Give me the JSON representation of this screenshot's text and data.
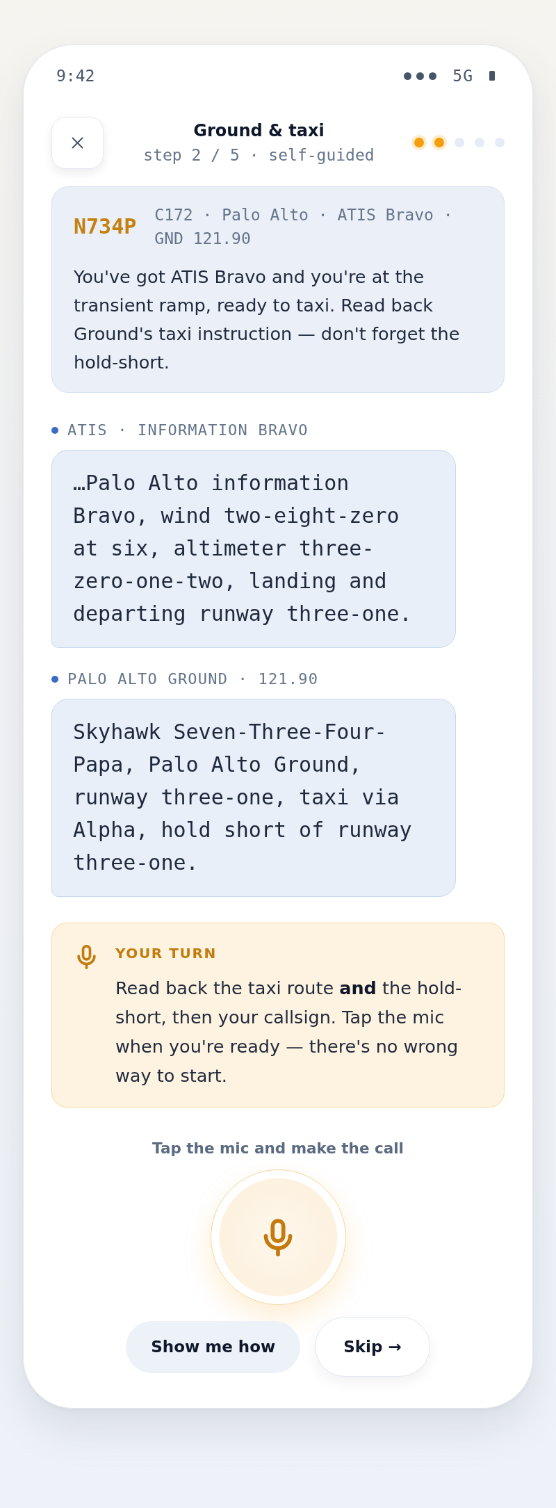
{
  "status_bar": {
    "time": "9:42",
    "network": "5G"
  },
  "header": {
    "title": "Ground & taxi",
    "subtitle": "step 2 / 5 · self-guided",
    "progress": [
      {
        "done": true
      },
      {
        "done": true
      },
      {
        "done": false
      },
      {
        "done": false
      },
      {
        "done": false
      }
    ]
  },
  "briefing": {
    "callsign": "N734P",
    "details": "C172 · Palo Alto · ATIS Bravo · GND 121.90",
    "text": "You've got ATIS Bravo and you're at the transient ramp, ready to taxi. Read back Ground's taxi instruction — don't forget the hold-short."
  },
  "transmissions": [
    {
      "source": "ATIS · INFORMATION BRAVO",
      "text": "…Palo Alto information Bravo, wind two-eight-zero at six, altimeter three-zero-one-two, landing and departing runway three-one."
    },
    {
      "source": "PALO ALTO GROUND · 121.90",
      "text": "Skyhawk Seven-Three-Four-Papa, Palo Alto Ground, runway three-one, taxi via Alpha, hold short of runway three-one."
    }
  ],
  "prompt": {
    "heading": "YOUR TURN",
    "text": "Read back the taxi route **and** the hold-short, then your callsign. Tap the mic when you're ready — there's no wrong way to start."
  },
  "record": {
    "hint": "Tap the mic and make the call"
  },
  "actions": [
    {
      "label": "Show me how",
      "kind": "secondary"
    },
    {
      "label": "Skip →",
      "kind": "outline"
    }
  ]
}
